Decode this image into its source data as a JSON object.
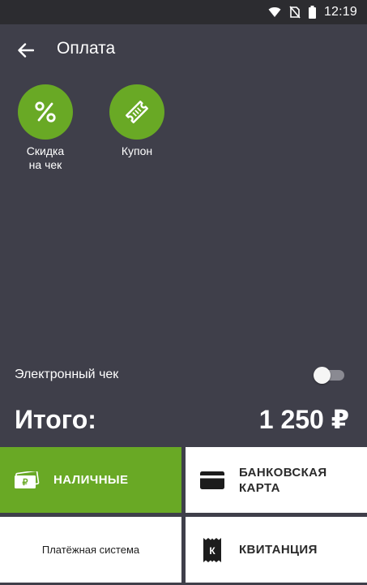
{
  "status_bar": {
    "time": "12:19",
    "icons": [
      "wifi-icon",
      "no-sim-icon",
      "battery-icon"
    ]
  },
  "header": {
    "title": "Оплата",
    "back_icon": "arrow-left-icon"
  },
  "actions": [
    {
      "label": "Скидка\nна чек",
      "icon": "percent-icon"
    },
    {
      "label": "Купон",
      "icon": "ticket-icon"
    }
  ],
  "electronic_receipt": {
    "label": "Электронный чек",
    "enabled": false
  },
  "total": {
    "label": "Итого:",
    "value": "1 250 ₽"
  },
  "payment_methods": {
    "cash": {
      "label": "НАЛИЧНЫЕ",
      "icon": "cash-icon"
    },
    "card": {
      "label": "БАНКОВСКАЯ\nКАРТА",
      "icon": "credit-card-icon"
    },
    "payment_system": {
      "label": "Платёжная система"
    },
    "receipt": {
      "label": "КВИТАНЦИЯ",
      "icon": "receipt-icon",
      "icon_letter": "К"
    }
  },
  "colors": {
    "accent_green": "#69a925",
    "background_dark": "#3f3f4a",
    "status_bar": "#2c2c30",
    "tile_white": "#ffffff"
  }
}
